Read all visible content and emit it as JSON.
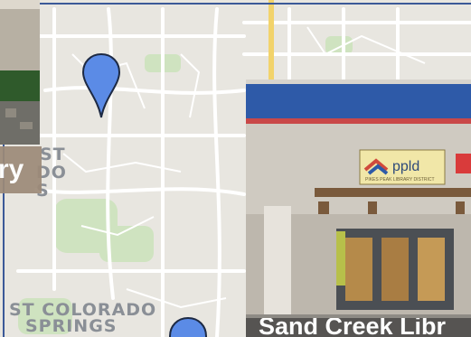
{
  "map": {
    "area_label_line1": "ST COLORADO",
    "area_label_line2": "SPRINGS",
    "fragment_1": "ST",
    "fragment_2": "DO",
    "fragment_3": "S",
    "road_color": "#ffffff",
    "highway_color": "#f2d36b",
    "park_color": "#c8dfb8",
    "pin_color": "#5b8be6",
    "pins": [
      "location-pin-north",
      "location-pin-south"
    ]
  },
  "photos": {
    "left_caption": "ry",
    "right_caption": "Sand Creek Libr",
    "right_sign_text": "ppld",
    "right_sign_subtext": "PIKES PEAK LIBRARY DISTRICT"
  },
  "colors": {
    "frame": "#3b5998",
    "caption_left_bg": "#9d8a78",
    "building_trim": "#c94848",
    "building_blue": "#2e5aa8"
  }
}
